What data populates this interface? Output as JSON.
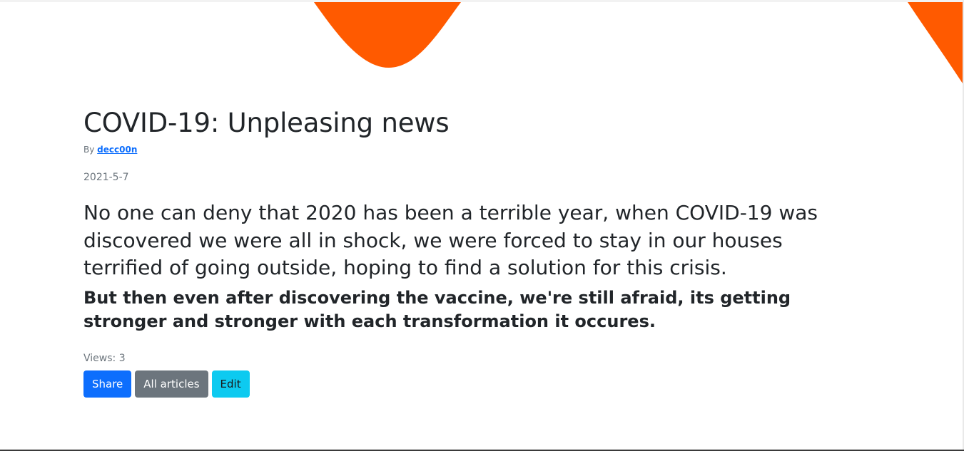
{
  "theme": {
    "accent": "#ff5a00",
    "primary": "#0d6efd",
    "secondary": "#6c757d",
    "info": "#0dcaf0",
    "text": "#212529",
    "muted": "#6c757d"
  },
  "article": {
    "title": "COVID-19: Unpleasing news",
    "by_label": "By",
    "author": "decc00n",
    "date": "2021-5-7",
    "lead": "No one can deny that 2020 has been a terrible year, when COVID-19 was discovered we were all in shock, we were forced to stay in our houses terrified of going outside, hoping to find a solution for this crisis.",
    "body": "But then even after discovering the vaccine, we're still afraid, its getting stronger and stronger with each transformation it occures.",
    "views_label": "Views:",
    "views": "3"
  },
  "actions": {
    "share": "Share",
    "all_articles": "All articles",
    "edit": "Edit"
  }
}
